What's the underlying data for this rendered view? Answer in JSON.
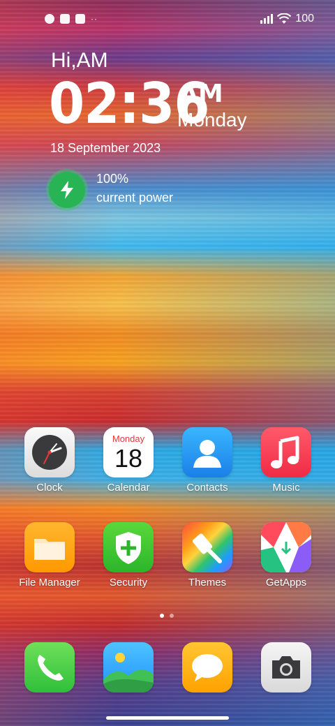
{
  "status_bar": {
    "battery": "100",
    "dots": "··"
  },
  "widget": {
    "greeting": "Hi,AM",
    "time": "02:36",
    "ampm": "AM",
    "day": "Monday",
    "date": "18 September 2023",
    "battery_percent": "100%",
    "battery_label": "current power"
  },
  "apps": [
    {
      "label": "Clock"
    },
    {
      "label": "Calendar",
      "icon_month": "Monday",
      "icon_day": "18"
    },
    {
      "label": "Contacts"
    },
    {
      "label": "Music"
    },
    {
      "label": "File Manager"
    },
    {
      "label": "Security"
    },
    {
      "label": "Themes"
    },
    {
      "label": "GetApps"
    }
  ],
  "dock": [
    {
      "name": "phone-icon"
    },
    {
      "name": "gallery-icon"
    },
    {
      "name": "messages-icon"
    },
    {
      "name": "camera-icon"
    }
  ],
  "colors": {
    "battery_green": "#28b454",
    "calendar_red": "#e53935"
  }
}
